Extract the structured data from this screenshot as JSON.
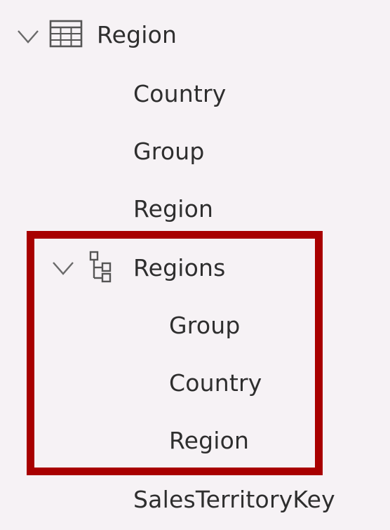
{
  "field_list": {
    "table": {
      "name": "Region",
      "icon": "table-icon",
      "expand_icon": "chevron-down-icon",
      "expanded": true,
      "fields": [
        {
          "label": "Country"
        },
        {
          "label": "Group"
        },
        {
          "label": "Region"
        }
      ],
      "hierarchy": {
        "name": "Regions",
        "icon": "hierarchy-icon",
        "expand_icon": "chevron-down-icon",
        "expanded": true,
        "levels": [
          {
            "label": "Group"
          },
          {
            "label": "Country"
          },
          {
            "label": "Region"
          }
        ]
      },
      "trailing_fields": [
        {
          "label": "SalesTerritoryKey"
        }
      ]
    }
  },
  "colors": {
    "pane_background": "#f6f2f5",
    "text": "#2e2e2e",
    "icon": "#555555",
    "highlight_border": "#a80000"
  }
}
